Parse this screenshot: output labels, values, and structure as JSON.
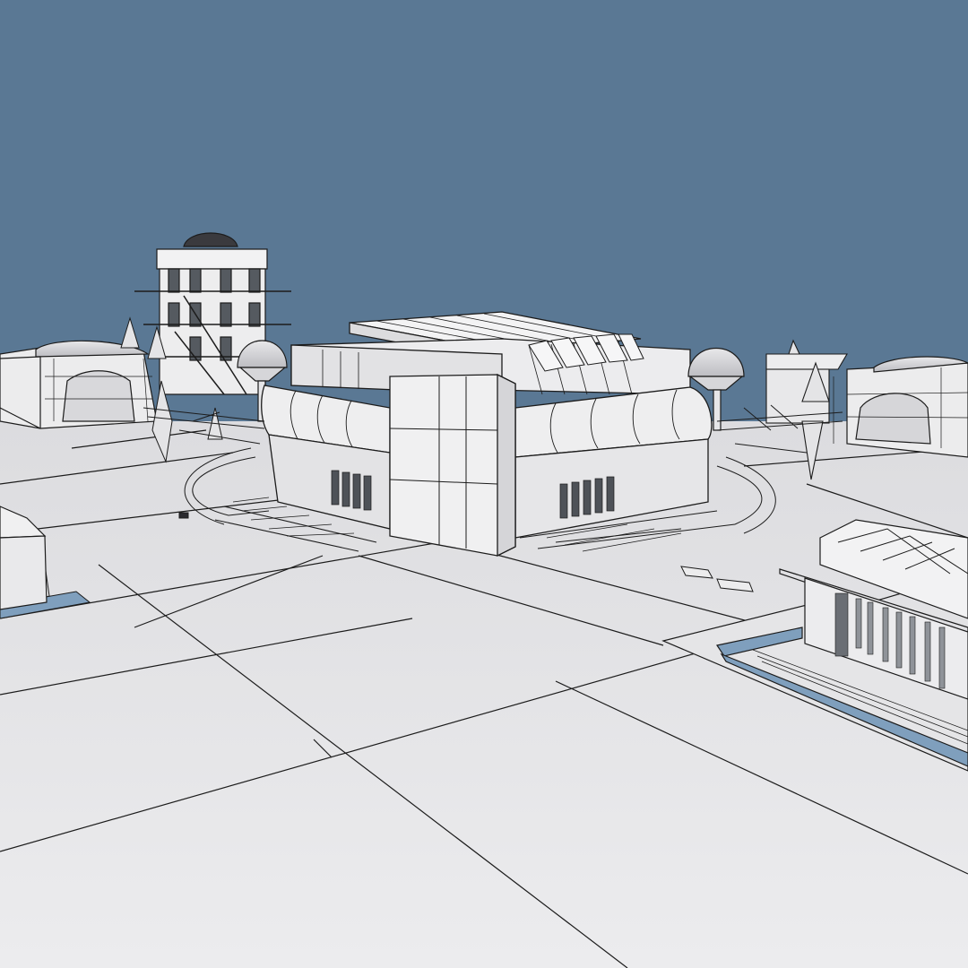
{
  "scene": {
    "render_style": "white clay wireframe architectural model",
    "colors": {
      "sky": "#5a7894",
      "ground": "#e6e6e8",
      "ground_shade": "#d9d9dc",
      "building": "#efeff0",
      "building_shade": "#d2d2d5",
      "wire": "#1c1c1c",
      "water": "#7f9fbd"
    }
  }
}
